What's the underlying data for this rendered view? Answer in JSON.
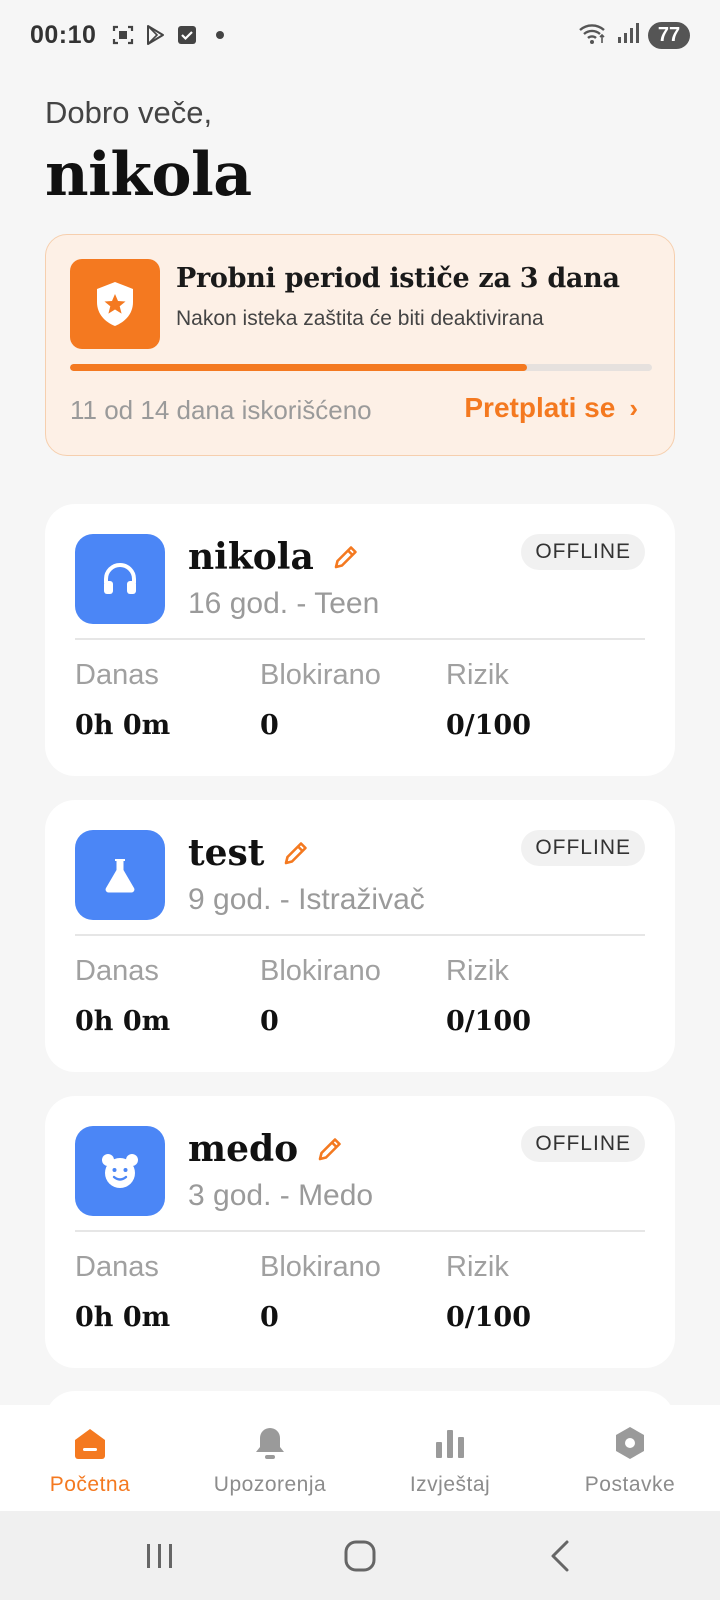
{
  "status_bar": {
    "time": "00:10",
    "battery": "77"
  },
  "greeting": {
    "line": "Dobro veče,",
    "name": "nikola"
  },
  "trial": {
    "title": "Probni period ističe za 3 dana",
    "subtitle": "Nakon isteka zaštita će biti deaktivirana",
    "used_text": "11 od 14 dana iskorišćeno",
    "used_days": 11,
    "total_days": 14,
    "cta": "Pretplati se",
    "cta_chevron": "›",
    "accent": "#f47920"
  },
  "profiles": [
    {
      "name": "nikola",
      "subtitle": "16 god. - Teen",
      "status": "OFFLINE",
      "icon": "headphones-icon",
      "stats": [
        {
          "label": "Danas",
          "value": "0h 0m"
        },
        {
          "label": "Blokirano",
          "value": "0"
        },
        {
          "label": "Rizik",
          "value": "0/100"
        }
      ]
    },
    {
      "name": "test",
      "subtitle": "9 god. - Istraživač",
      "status": "OFFLINE",
      "icon": "flask-icon",
      "stats": [
        {
          "label": "Danas",
          "value": "0h 0m"
        },
        {
          "label": "Blokirano",
          "value": "0"
        },
        {
          "label": "Rizik",
          "value": "0/100"
        }
      ]
    },
    {
      "name": "medo",
      "subtitle": "3 god. - Medo",
      "status": "OFFLINE",
      "icon": "bear-icon",
      "stats": [
        {
          "label": "Danas",
          "value": "0h 0m"
        },
        {
          "label": "Blokirano",
          "value": "0"
        },
        {
          "label": "Rizik",
          "value": "0/100"
        }
      ]
    }
  ],
  "bottom_nav": {
    "items": [
      {
        "label": "Početna",
        "icon": "home-icon",
        "active": true
      },
      {
        "label": "Upozorenja",
        "icon": "bell-icon",
        "active": false
      },
      {
        "label": "Izvještaj",
        "icon": "bar-chart-icon",
        "active": false
      },
      {
        "label": "Postavke",
        "icon": "settings-icon",
        "active": false
      }
    ]
  },
  "colors": {
    "accent": "#f47920",
    "avatar_blue": "#4b86f6",
    "trial_bg": "#fdf0e6"
  }
}
